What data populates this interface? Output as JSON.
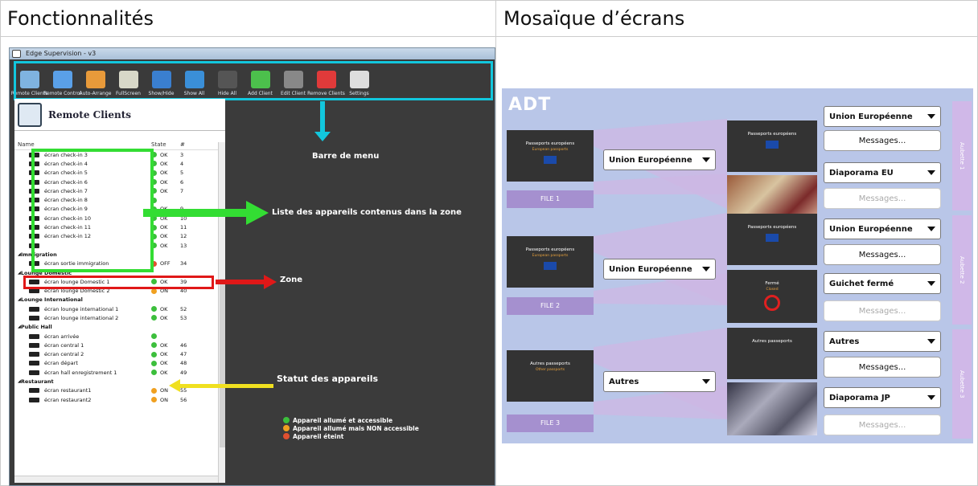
{
  "headers": {
    "left": "Fonctionnalités",
    "right": "Mosaïque d’écrans"
  },
  "app": {
    "title": "Edge Supervision - v3",
    "toolbar": [
      {
        "label": "Remote Clients",
        "icon": "remote-clients-icon",
        "color": "#7fb3e0"
      },
      {
        "label": "Remote Control",
        "icon": "remote-control-icon",
        "color": "#5aa0e8"
      },
      {
        "label": "Auto-Arrange",
        "icon": "auto-arrange-icon",
        "color": "#e89a3a"
      },
      {
        "label": "FullScreen",
        "icon": "fullscreen-icon",
        "color": "#d8d8c8"
      },
      {
        "label": "Show/Hide",
        "icon": "show-hide-icon",
        "color": "#3a7fd0"
      },
      {
        "label": "Show All",
        "icon": "show-all-icon",
        "color": "#3a8fd8"
      },
      {
        "label": "Hide All",
        "icon": "hide-all-icon",
        "color": "#555555"
      },
      {
        "label": "Add Client",
        "icon": "add-client-icon",
        "color": "#4cc04c"
      },
      {
        "label": "Edit Client",
        "icon": "edit-client-icon",
        "color": "#888888"
      },
      {
        "label": "Remove Clients",
        "icon": "remove-clients-icon",
        "color": "#e03a3a"
      },
      {
        "label": "Settings",
        "icon": "settings-icon",
        "color": "#dddddd"
      }
    ],
    "panel_title": "Remote Clients",
    "columns": [
      "Name",
      "State",
      "#"
    ],
    "rows": [
      {
        "type": "item",
        "name": "écran check-in 3",
        "state": "OK",
        "num": "3",
        "status": "green"
      },
      {
        "type": "item",
        "name": "écran check-in 4",
        "state": "OK",
        "num": "4",
        "status": "green"
      },
      {
        "type": "item",
        "name": "écran check-in 5",
        "state": "OK",
        "num": "5",
        "status": "green"
      },
      {
        "type": "item",
        "name": "écran check-in 6",
        "state": "OK",
        "num": "6",
        "status": "green"
      },
      {
        "type": "item",
        "name": "écran check-in 7",
        "state": "OK",
        "num": "7",
        "status": "green"
      },
      {
        "type": "item",
        "name": "écran check-in 8",
        "state": "",
        "num": "",
        "status": "green"
      },
      {
        "type": "item",
        "name": "écran check-in 9",
        "state": "OK",
        "num": "9",
        "status": "green"
      },
      {
        "type": "item",
        "name": "écran check-in 10",
        "state": "OK",
        "num": "10",
        "status": "green"
      },
      {
        "type": "item",
        "name": "écran check-in 11",
        "state": "OK",
        "num": "11",
        "status": "green"
      },
      {
        "type": "item",
        "name": "écran check-in 12",
        "state": "OK",
        "num": "12",
        "status": "green"
      },
      {
        "type": "item",
        "name": "",
        "state": "OK",
        "num": "13",
        "status": "green"
      },
      {
        "type": "group",
        "name": "Immigration"
      },
      {
        "type": "item",
        "name": "écran sortie immigration",
        "state": "OFF",
        "num": "34",
        "status": "red"
      },
      {
        "type": "group",
        "name": "Lounge Domestic"
      },
      {
        "type": "item",
        "name": "écran lounge Domestic 1",
        "state": "OK",
        "num": "39",
        "status": "green"
      },
      {
        "type": "item",
        "name": "écran lounge Domestic 2",
        "state": "ON",
        "num": "40",
        "status": "orange"
      },
      {
        "type": "group",
        "name": "Lounge International"
      },
      {
        "type": "item",
        "name": "écran lounge international 1",
        "state": "OK",
        "num": "52",
        "status": "green"
      },
      {
        "type": "item",
        "name": "écran lounge international 2",
        "state": "OK",
        "num": "53",
        "status": "green"
      },
      {
        "type": "group",
        "name": "Public Hall"
      },
      {
        "type": "item",
        "name": "écran arrivée",
        "state": "",
        "num": "",
        "status": "green"
      },
      {
        "type": "item",
        "name": "écran central 1",
        "state": "OK",
        "num": "46",
        "status": "green"
      },
      {
        "type": "item",
        "name": "écran central 2",
        "state": "OK",
        "num": "47",
        "status": "green"
      },
      {
        "type": "item",
        "name": "écran départ",
        "state": "OK",
        "num": "48",
        "status": "green"
      },
      {
        "type": "item",
        "name": "écran hall enregistrement 1",
        "state": "OK",
        "num": "49",
        "status": "green"
      },
      {
        "type": "group",
        "name": "Restaurant"
      },
      {
        "type": "item",
        "name": "écran restaurant1",
        "state": "ON",
        "num": "55",
        "status": "orange"
      },
      {
        "type": "item",
        "name": "écran restaurant2",
        "state": "ON",
        "num": "56",
        "status": "orange"
      }
    ],
    "annotations": {
      "menu": "Barre de menu",
      "list": "Liste des appareils contenus dans la zone",
      "zone": "Zone",
      "status": "Statut des appareils"
    },
    "legend": [
      {
        "text": "Appareil allumé et accessible",
        "color": "#3cbf3c"
      },
      {
        "text": "Appareil allumé mais NON accessible",
        "color": "#f0a020"
      },
      {
        "text": "Appareil éteint",
        "color": "#e05030"
      }
    ]
  },
  "mosaic": {
    "brand": "ADT",
    "files": [
      {
        "thumb_title": "Passeports européens",
        "thumb_sub": "European passports",
        "file": "FILE 1",
        "select": "Union Européenne"
      },
      {
        "thumb_title": "Passeports européens",
        "thumb_sub": "European passports",
        "file": "FILE 2",
        "select": "Union Européenne"
      },
      {
        "thumb_title": "Autres passeports",
        "thumb_sub": "Other passports",
        "file": "FILE 3",
        "select": "Autres"
      }
    ],
    "aubettes": [
      {
        "band": "Aubette 1",
        "top_thumb": "Passeports européens",
        "sel1": "Union Européenne",
        "btn1": "Messages...",
        "sel2": "Diaporama EU",
        "btn2": "Messages..."
      },
      {
        "band": "Aubette 2",
        "top_thumb": "Passeports européens",
        "bottom_thumb": "Fermé",
        "bottom_sub": "Closed",
        "sel1": "Union Européenne",
        "btn1": "Messages...",
        "sel2": "Guichet fermé",
        "btn2": "Messages..."
      },
      {
        "band": "Aubette 3",
        "top_thumb": "Autres passeports",
        "sel1": "Autres",
        "btn1": "Messages...",
        "sel2": "Diaporama JP",
        "btn2": "Messages..."
      }
    ]
  }
}
